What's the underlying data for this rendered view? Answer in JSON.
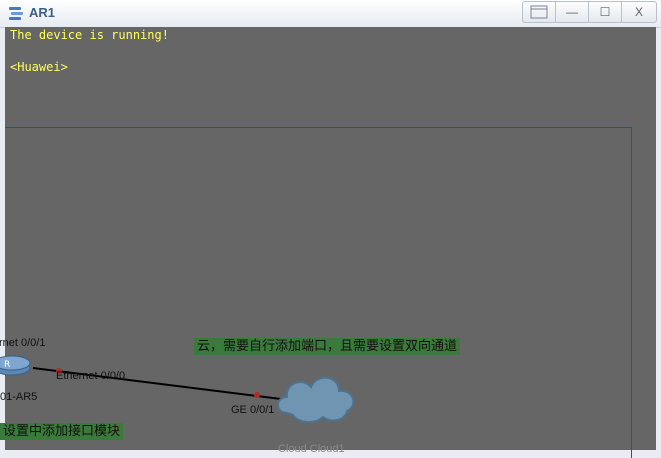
{
  "window": {
    "title": "AR1",
    "buttons": {
      "restore_label": "",
      "minimize_label": "—",
      "maximize_label": "☐",
      "close_label": "X"
    }
  },
  "console": {
    "lines": [
      "The device is running!",
      "<Huawei>"
    ],
    "text_color": "#ffff5a",
    "background": "#666666"
  },
  "topology": {
    "router": {
      "name": "01-AR5",
      "port_top": "rnet 0/0/1",
      "port_right": "Ethernet 0/0/0"
    },
    "cloud": {
      "name": "Cloud Cloud1",
      "port": "GE 0/0/1"
    },
    "notes": [
      "云，需要自行添加端口，且需要设置双向通道",
      "设置中添加接口模块"
    ],
    "note_color": "#3a7a3a"
  }
}
